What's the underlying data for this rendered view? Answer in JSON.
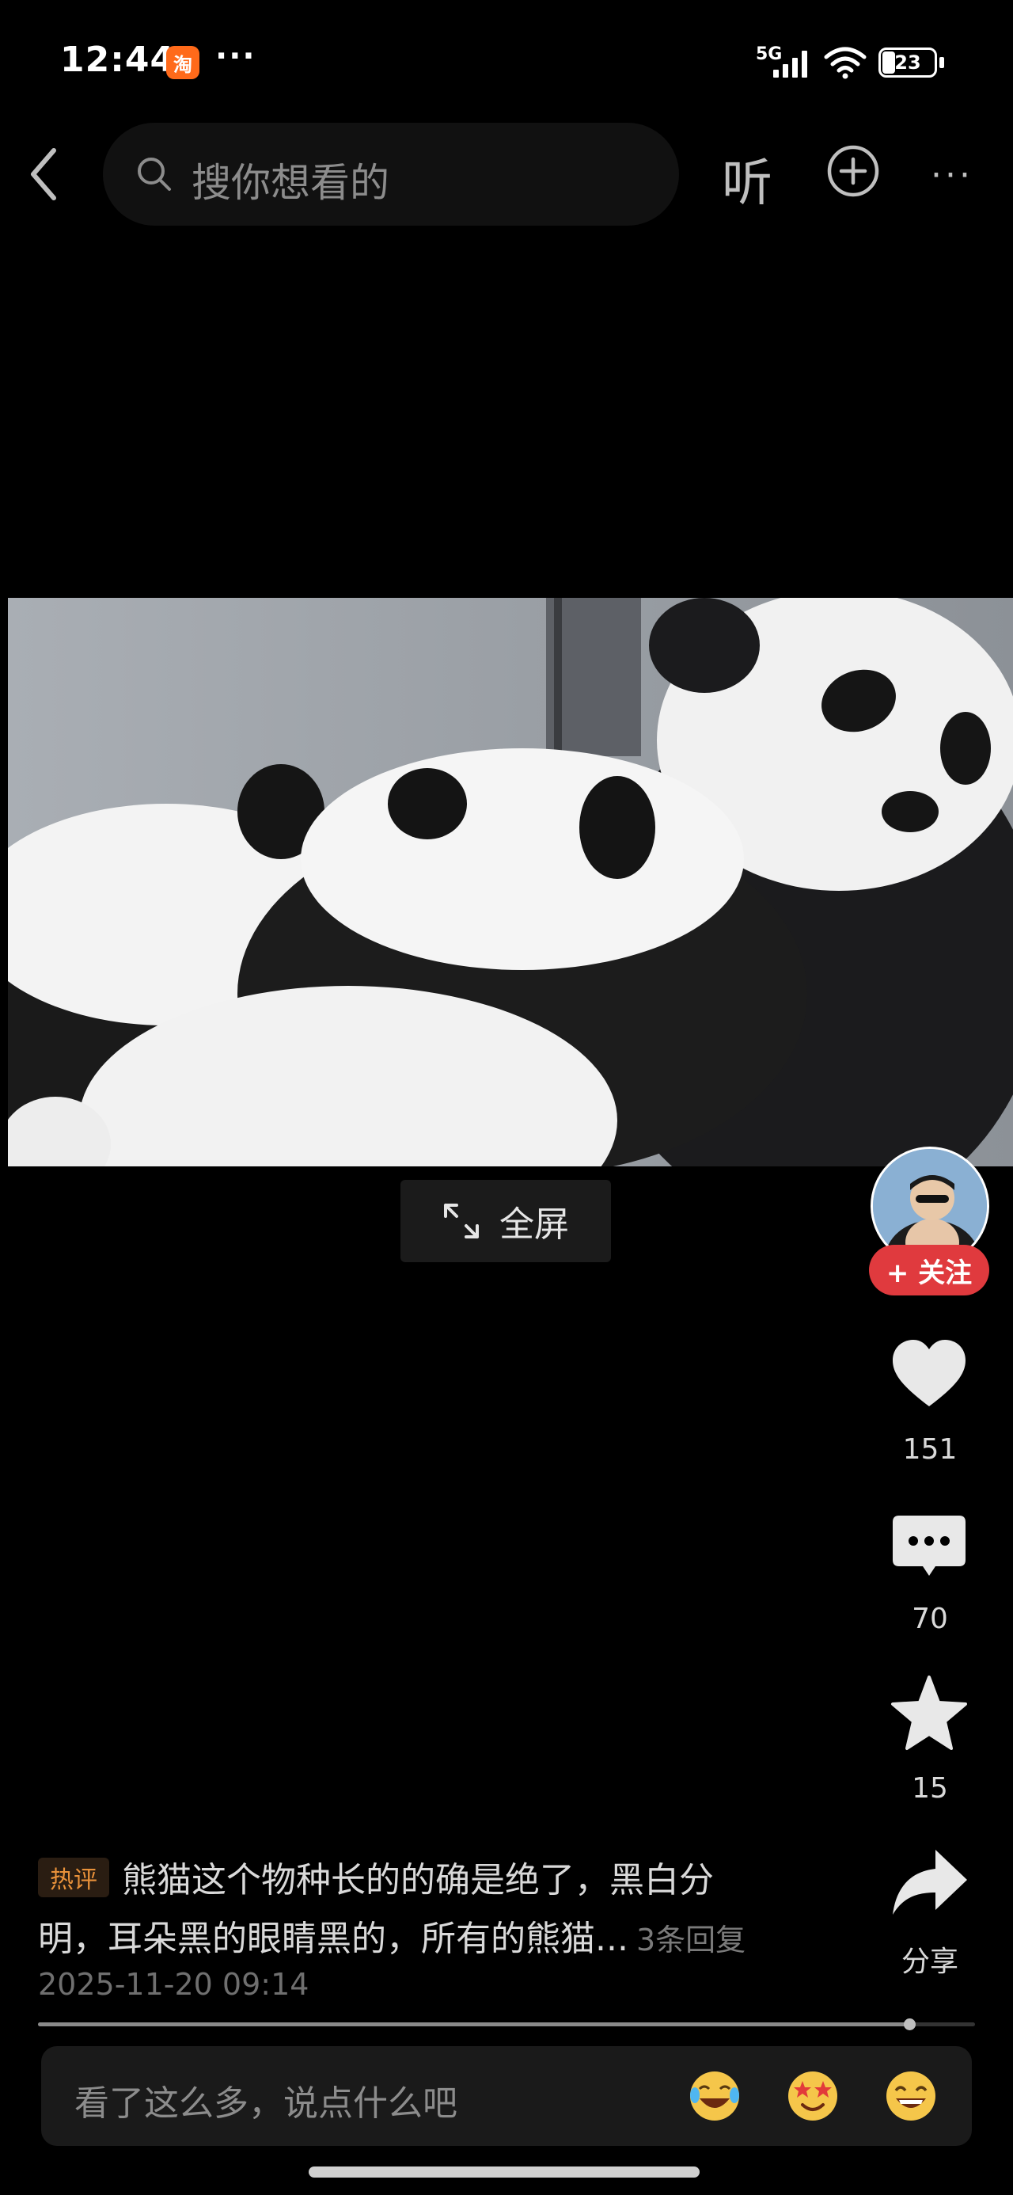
{
  "status_bar": {
    "time": "12:44",
    "app_icon_label": "淘",
    "dots": "···",
    "network": "5G",
    "battery": "23"
  },
  "nav": {
    "search_placeholder": "搜你想看的",
    "listen_label": "听",
    "more_label": "···"
  },
  "video": {
    "fullscreen_label": "全屏"
  },
  "rail": {
    "follow_label": "+ 关注",
    "likes": "151",
    "comments": "70",
    "favorites": "15",
    "share_label": "分享"
  },
  "hot_comment": {
    "badge": "热评",
    "line1": "熊猫这个物种长的的确是绝了，黑白分",
    "line2": "明，耳朵黑的眼睛黑的，所有的熊猫...",
    "replies": "3条回复",
    "time": "2025-11-20 09:14"
  },
  "progress": {
    "fraction": 0.93
  },
  "comment_bar": {
    "placeholder": "看了这么多，说点什么吧"
  },
  "icons": {
    "like": "heart-icon",
    "comment": "chat-bubble-icon",
    "favorite": "star-icon",
    "share": "share-arrow-icon"
  }
}
